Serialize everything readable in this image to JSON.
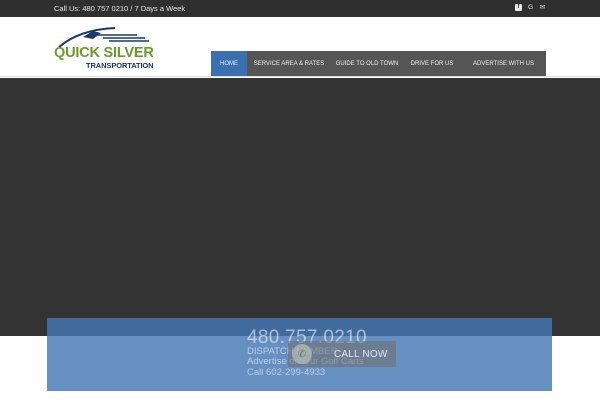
{
  "topbar": {
    "call_text": "Call Us: 480 757 0210 / 7 Days a Week",
    "social": [
      {
        "icon": "facebook-icon",
        "glyph": "f"
      },
      {
        "icon": "google-icon",
        "glyph": "G"
      },
      {
        "icon": "envelope-icon",
        "glyph": "✉"
      }
    ]
  },
  "logo": {
    "line1": "QUICK SILVER",
    "line2": "TRANSPORTATION"
  },
  "nav": {
    "items": [
      {
        "label": "HOME",
        "active": true
      },
      {
        "label": "SERVICE AREA & RATES",
        "active": false
      },
      {
        "label": "GUIDE TO OLD TOWN",
        "active": false
      },
      {
        "label": "DRIVE FOR US",
        "active": false
      },
      {
        "label": "ADVERTISE WITH US",
        "active": false
      }
    ]
  },
  "overlay": {
    "phone": "480.757.0210",
    "dispatch": "DISPATCH NUMBER",
    "advertise": "Advertise on Our Golf Carts",
    "golf_call": "Call 602-299-4933",
    "call_now": "CALL NOW"
  },
  "colors": {
    "topbar_bg": "#2f2f2f",
    "nav_bg": "#555555",
    "nav_active": "#3a6fb0",
    "hero_bg": "#333333",
    "logo_green": "#6a9a2b",
    "logo_navy": "#1a3a63",
    "overlay": "#4678b4"
  }
}
